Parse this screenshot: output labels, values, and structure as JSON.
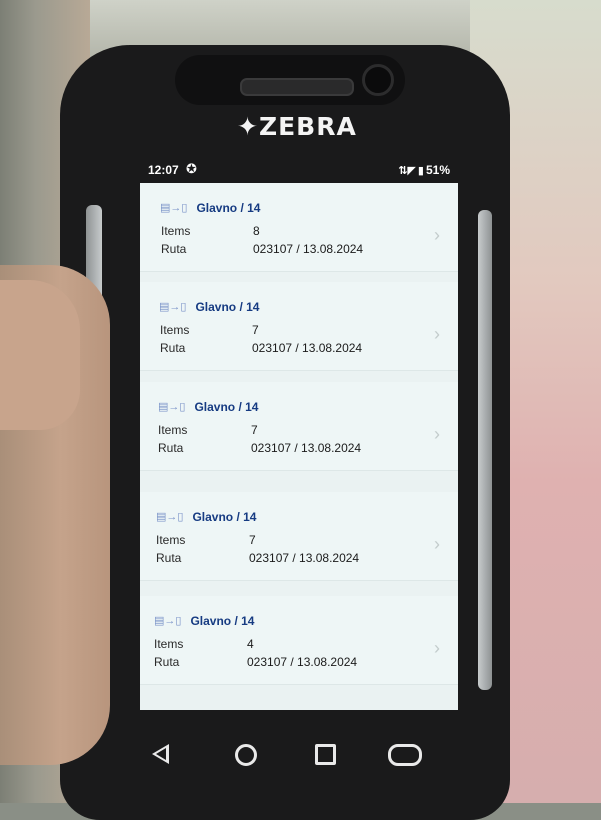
{
  "device": {
    "brand": "ZEBRA"
  },
  "status_bar": {
    "time": "12:07",
    "battery": "51%",
    "icons": [
      "sync-icon",
      "signal-icon",
      "battery-icon"
    ]
  },
  "list": {
    "item_label": "Items",
    "route_label": "Ruta",
    "cards": [
      {
        "title": "Glavno / 14",
        "items": "8",
        "route": "023107 / 13.08.2024"
      },
      {
        "title": "Glavno / 14",
        "items": "7",
        "route": "023107 / 13.08.2024"
      },
      {
        "title": "Glavno / 14",
        "items": "7",
        "route": "023107 / 13.08.2024"
      },
      {
        "title": "Glavno / 14",
        "items": "7",
        "route": "023107 / 13.08.2024"
      },
      {
        "title": "Glavno / 14",
        "items": "4",
        "route": "023107 / 13.08.2024"
      }
    ]
  },
  "navigation": {
    "buttons": [
      "back-icon",
      "home-icon",
      "recents-icon",
      "assistant-icon"
    ]
  },
  "colors": {
    "title_blue": "#163b82",
    "screen_bg": "#eaf2f2",
    "device_body": "#1a1a1b"
  }
}
